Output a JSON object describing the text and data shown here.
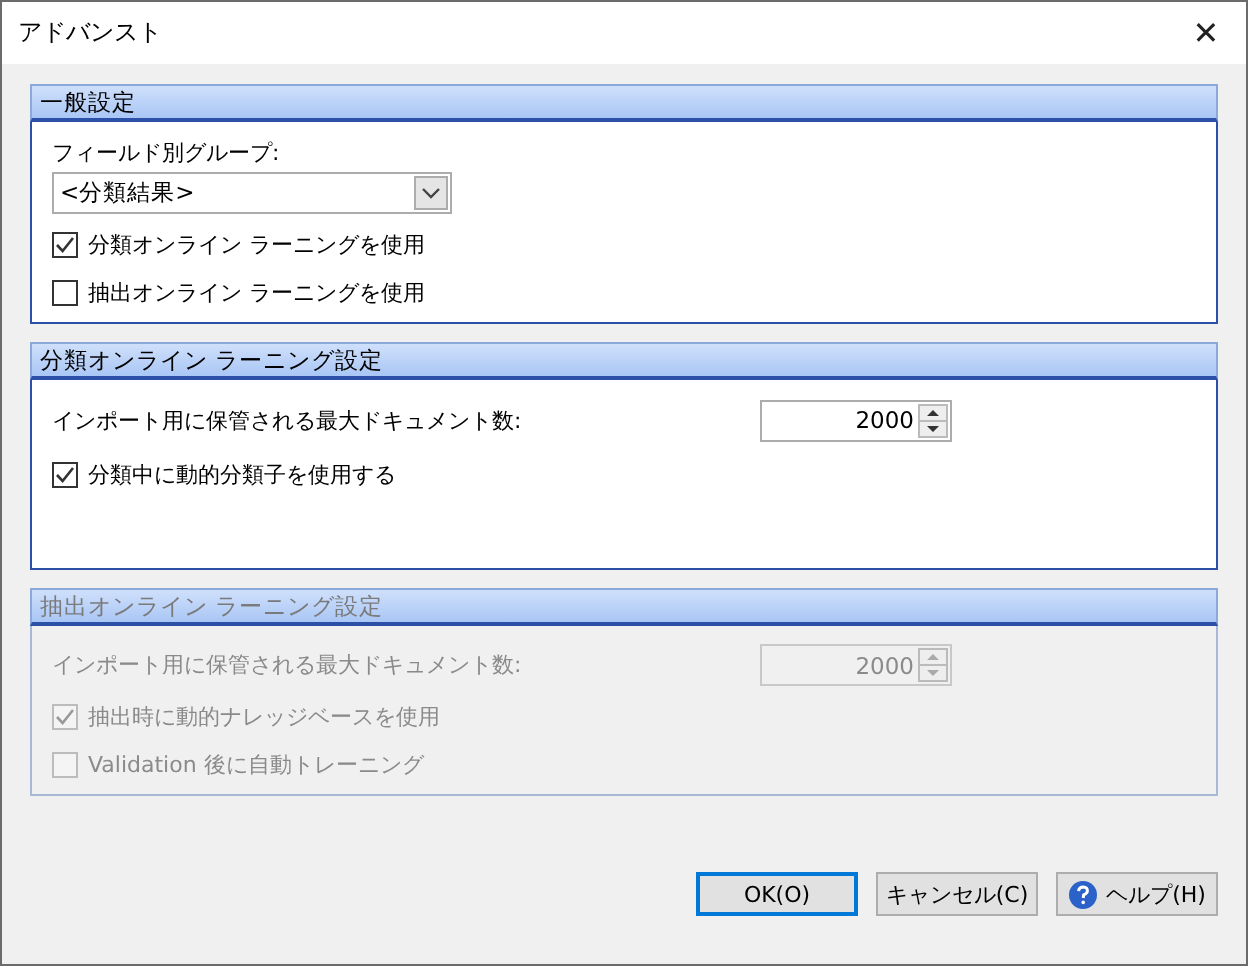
{
  "window": {
    "title": "アドバンスト",
    "close": "✕"
  },
  "sections": [
    {
      "title": "一般設定",
      "disabled": false,
      "items": [
        {
          "kind": "dropdown",
          "label": "フィールド別グループ:",
          "value": "<分類結果>"
        },
        {
          "kind": "checkbox",
          "label": "分類オンライン ラーニングを使用",
          "checked": true
        },
        {
          "kind": "checkbox",
          "label": "抽出オンライン ラーニングを使用",
          "checked": false
        }
      ]
    },
    {
      "title": "分類オンライン ラーニング設定",
      "disabled": false,
      "items": [
        {
          "kind": "spinner",
          "label": "インポート用に保管される最大ドキュメント数:",
          "value": "2000"
        },
        {
          "kind": "checkbox",
          "label": "分類中に動的分類子を使用する",
          "checked": true
        }
      ]
    },
    {
      "title": "抽出オンライン ラーニング設定",
      "disabled": true,
      "items": [
        {
          "kind": "spinner",
          "label": "インポート用に保管される最大ドキュメント数:",
          "value": "2000"
        },
        {
          "kind": "checkbox",
          "label": "抽出時に動的ナレッジベースを使用",
          "checked": true
        },
        {
          "kind": "checkbox",
          "label": "Validation 後に自動トレーニング",
          "checked": false
        }
      ]
    }
  ],
  "buttons": [
    {
      "kind": "ok",
      "label": "OK(O)",
      "default": true
    },
    {
      "kind": "cancel",
      "label": "キャンセル(C)",
      "default": false
    },
    {
      "kind": "help",
      "label": "ヘルプ(H)",
      "default": false
    }
  ]
}
